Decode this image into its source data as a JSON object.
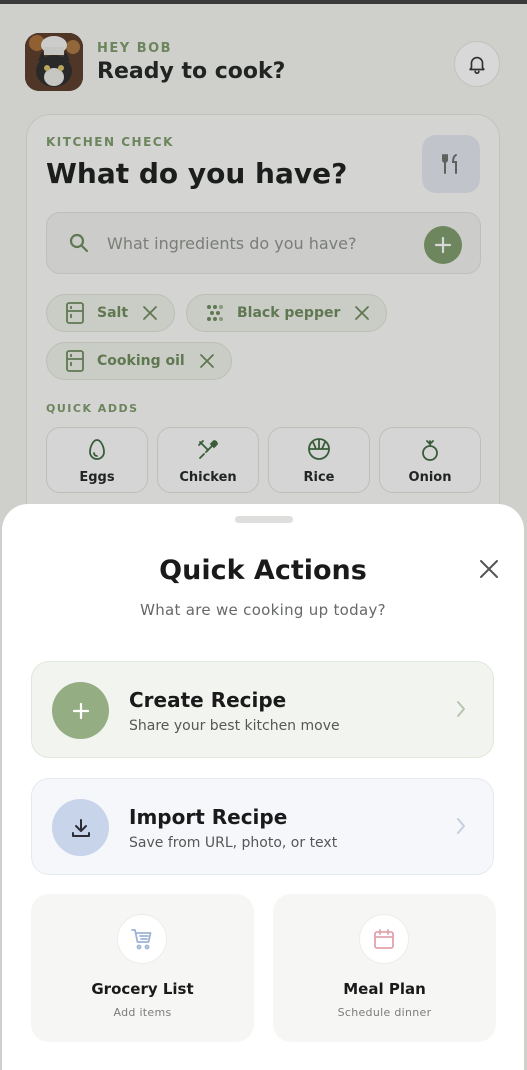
{
  "header": {
    "greeting": "HEY BOB",
    "title": "Ready to cook?"
  },
  "kitchen_check": {
    "label": "KITCHEN CHECK",
    "title": "What do you have?",
    "search_placeholder": "What ingredients do you have?",
    "chips": [
      {
        "label": "Salt",
        "icon": "fridge-icon"
      },
      {
        "label": "Black pepper",
        "icon": "dots-icon"
      },
      {
        "label": "Cooking oil",
        "icon": "fridge-icon"
      }
    ],
    "quick_adds_label": "QUICK ADDS",
    "quick_adds": [
      {
        "label": "Eggs",
        "icon": "egg-icon"
      },
      {
        "label": "Chicken",
        "icon": "drumstick-icon"
      },
      {
        "label": "Rice",
        "icon": "rice-bowl-icon"
      },
      {
        "label": "Onion",
        "icon": "onion-icon"
      }
    ]
  },
  "sheet": {
    "title": "Quick Actions",
    "subtitle": "What are we cooking up today?",
    "create": {
      "title": "Create Recipe",
      "subtitle": "Share your best kitchen move"
    },
    "import": {
      "title": "Import Recipe",
      "subtitle": "Save from URL, photo, or text"
    },
    "grocery": {
      "title": "Grocery List",
      "subtitle": "Add items"
    },
    "meal_plan": {
      "title": "Meal Plan",
      "subtitle": "Schedule dinner"
    }
  },
  "colors": {
    "accent_green": "#7e9c6a",
    "import_blue": "#c7d4ea",
    "meal_plan_pink": "#e2a2ad",
    "grocery_blue": "#9db3d6"
  }
}
